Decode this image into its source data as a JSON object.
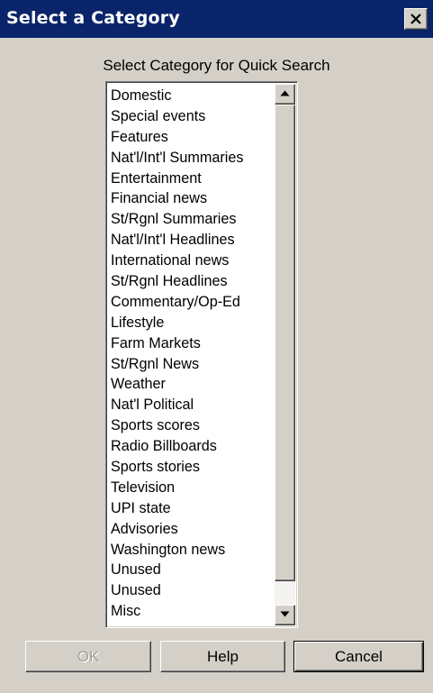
{
  "window": {
    "title": "Select a Category",
    "close_icon": "close-x-icon"
  },
  "prompt": "Select Category for Quick Search",
  "categories": [
    "Domestic",
    "Special events",
    "Features",
    "Nat'l/Int'l Summaries",
    "Entertainment",
    "Financial news",
    "St/Rgnl Summaries",
    "Nat'l/Int'l Headlines",
    "International news",
    "St/Rgnl Headlines",
    "Commentary/Op-Ed",
    "Lifestyle",
    "Farm Markets",
    "St/Rgnl News",
    "Weather",
    "Nat'l Political",
    "Sports scores",
    "Radio Billboards",
    "Sports stories",
    "Television",
    "UPI state",
    "Advisories",
    "Washington news",
    "Unused",
    "Unused",
    "Misc"
  ],
  "scrollbar": {
    "up_icon": "scroll-up-arrow-icon",
    "down_icon": "scroll-down-arrow-icon"
  },
  "buttons": {
    "ok": "OK",
    "help": "Help",
    "cancel": "Cancel"
  },
  "colors": {
    "titlebar": "#0a246a",
    "face": "#d4d0c8",
    "disabled_text": "#a0a0a0"
  }
}
